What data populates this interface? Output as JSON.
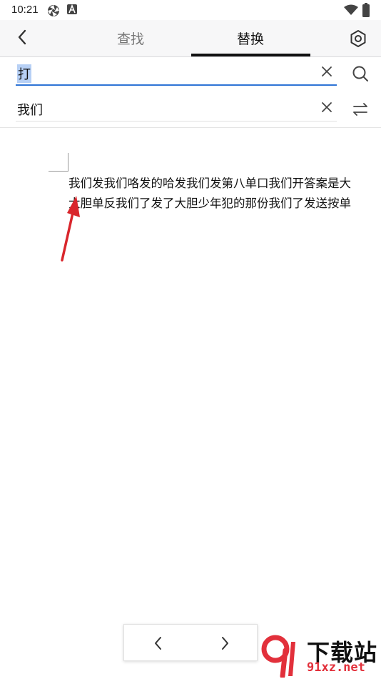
{
  "status_bar": {
    "time": "10:21",
    "icons": [
      "aperture-icon",
      "a-badge-icon",
      "wifi-icon",
      "battery-icon"
    ]
  },
  "header": {
    "tabs": [
      {
        "label": "查找",
        "active": false
      },
      {
        "label": "替换",
        "active": true
      }
    ],
    "back_icon": "chevron-left-icon",
    "settings_icon": "hexagon-gear-icon"
  },
  "find": {
    "value": "打",
    "action_icon": "search-icon"
  },
  "replace": {
    "value": "我们",
    "action_icon": "swap-arrows-icon"
  },
  "document": {
    "lines": [
      "我们发我们咯发的哈发我们发第八单口我们开答案是大",
      "大胆单反我们了发了大胆少年犯的那份我们了发送按单"
    ]
  },
  "nav": {
    "prev_icon": "chevron-left-icon",
    "next_icon": "chevron-right-icon"
  },
  "watermark": {
    "text": "下载站",
    "url": "91xz.net"
  },
  "colors": {
    "accent": "#2f74d6",
    "selection": "#b7d0f5",
    "annotation_arrow": "#d9262c",
    "watermark_red": "#e2303b"
  }
}
